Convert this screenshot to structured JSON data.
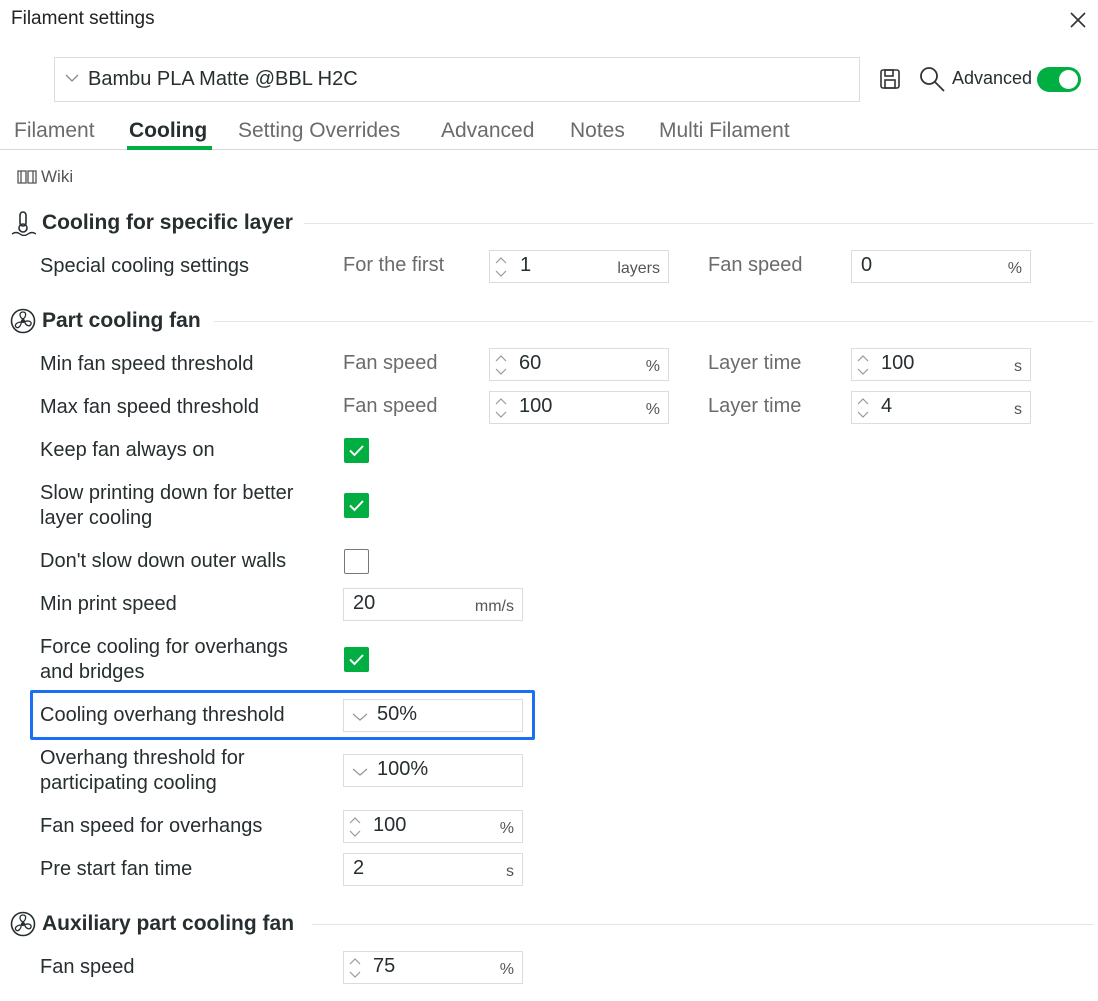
{
  "window": {
    "title": "Filament settings"
  },
  "header": {
    "preset": "Bambu PLA Matte @BBL H2C",
    "advanced_label": "Advanced",
    "advanced_on": true
  },
  "tabs": [
    {
      "label": "Filament",
      "active": false
    },
    {
      "label": "Cooling",
      "active": true
    },
    {
      "label": "Setting Overrides",
      "active": false
    },
    {
      "label": "Advanced",
      "active": false
    },
    {
      "label": "Notes",
      "active": false
    },
    {
      "label": "Multi Filament",
      "active": false
    }
  ],
  "wiki_label": "Wiki",
  "sections": {
    "specific_layer": {
      "title": "Cooling for specific layer",
      "special": {
        "label": "Special cooling settings",
        "first_label": "For the first",
        "first_value": "1",
        "first_unit": "layers",
        "fan_label": "Fan speed",
        "fan_value": "0",
        "fan_unit": "%"
      }
    },
    "part_fan": {
      "title": "Part cooling fan",
      "min_threshold": {
        "label": "Min fan speed threshold",
        "fan_label": "Fan speed",
        "fan_value": "60",
        "fan_unit": "%",
        "time_label": "Layer time",
        "time_value": "100",
        "time_unit": "s"
      },
      "max_threshold": {
        "label": "Max fan speed threshold",
        "fan_label": "Fan speed",
        "fan_value": "100",
        "fan_unit": "%",
        "time_label": "Layer time",
        "time_value": "4",
        "time_unit": "s"
      },
      "keep_fan_on": {
        "label": "Keep fan always on",
        "checked": true
      },
      "slow_down": {
        "label_line1": "Slow printing down for better",
        "label_line2": "layer cooling",
        "checked": true
      },
      "dont_slow_outer": {
        "label": "Don't slow down outer walls",
        "checked": false
      },
      "min_print_speed": {
        "label": "Min print speed",
        "value": "20",
        "unit": "mm/s"
      },
      "force_cooling": {
        "label_line1": "Force cooling for overhangs",
        "label_line2": "and bridges",
        "checked": true
      },
      "overhang_threshold": {
        "label": "Cooling overhang threshold",
        "value": "50%"
      },
      "overhang_participating": {
        "label_line1": "Overhang threshold for",
        "label_line2": "participating cooling",
        "value": "100%"
      },
      "fan_overhangs": {
        "label": "Fan speed for overhangs",
        "value": "100",
        "unit": "%"
      },
      "pre_start": {
        "label": "Pre start fan time",
        "value": "2",
        "unit": "s"
      }
    },
    "aux_fan": {
      "title": "Auxiliary part cooling fan",
      "fan_speed": {
        "label": "Fan speed",
        "value": "75",
        "unit": "%"
      }
    }
  },
  "colors": {
    "accent": "#00ae42",
    "highlight": "#1b6ff5"
  }
}
